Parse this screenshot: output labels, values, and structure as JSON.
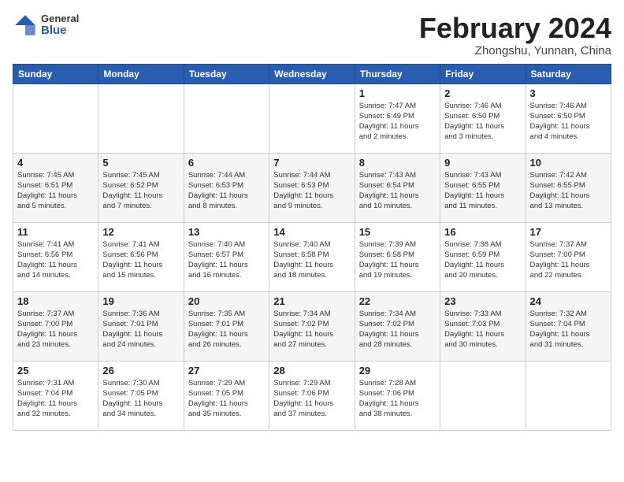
{
  "logo": {
    "general": "General",
    "blue": "Blue"
  },
  "header": {
    "month": "February 2024",
    "location": "Zhongshu, Yunnan, China"
  },
  "weekdays": [
    "Sunday",
    "Monday",
    "Tuesday",
    "Wednesday",
    "Thursday",
    "Friday",
    "Saturday"
  ],
  "weeks": [
    [
      {
        "day": "",
        "info": ""
      },
      {
        "day": "",
        "info": ""
      },
      {
        "day": "",
        "info": ""
      },
      {
        "day": "",
        "info": ""
      },
      {
        "day": "1",
        "info": "Sunrise: 7:47 AM\nSunset: 6:49 PM\nDaylight: 11 hours\nand 2 minutes."
      },
      {
        "day": "2",
        "info": "Sunrise: 7:46 AM\nSunset: 6:50 PM\nDaylight: 11 hours\nand 3 minutes."
      },
      {
        "day": "3",
        "info": "Sunrise: 7:46 AM\nSunset: 6:50 PM\nDaylight: 11 hours\nand 4 minutes."
      }
    ],
    [
      {
        "day": "4",
        "info": "Sunrise: 7:45 AM\nSunset: 6:51 PM\nDaylight: 11 hours\nand 5 minutes."
      },
      {
        "day": "5",
        "info": "Sunrise: 7:45 AM\nSunset: 6:52 PM\nDaylight: 11 hours\nand 7 minutes."
      },
      {
        "day": "6",
        "info": "Sunrise: 7:44 AM\nSunset: 6:53 PM\nDaylight: 11 hours\nand 8 minutes."
      },
      {
        "day": "7",
        "info": "Sunrise: 7:44 AM\nSunset: 6:53 PM\nDaylight: 11 hours\nand 9 minutes."
      },
      {
        "day": "8",
        "info": "Sunrise: 7:43 AM\nSunset: 6:54 PM\nDaylight: 11 hours\nand 10 minutes."
      },
      {
        "day": "9",
        "info": "Sunrise: 7:43 AM\nSunset: 6:55 PM\nDaylight: 11 hours\nand 11 minutes."
      },
      {
        "day": "10",
        "info": "Sunrise: 7:42 AM\nSunset: 6:55 PM\nDaylight: 11 hours\nand 13 minutes."
      }
    ],
    [
      {
        "day": "11",
        "info": "Sunrise: 7:41 AM\nSunset: 6:56 PM\nDaylight: 11 hours\nand 14 minutes."
      },
      {
        "day": "12",
        "info": "Sunrise: 7:41 AM\nSunset: 6:56 PM\nDaylight: 11 hours\nand 15 minutes."
      },
      {
        "day": "13",
        "info": "Sunrise: 7:40 AM\nSunset: 6:57 PM\nDaylight: 11 hours\nand 16 minutes."
      },
      {
        "day": "14",
        "info": "Sunrise: 7:40 AM\nSunset: 6:58 PM\nDaylight: 11 hours\nand 18 minutes."
      },
      {
        "day": "15",
        "info": "Sunrise: 7:39 AM\nSunset: 6:58 PM\nDaylight: 11 hours\nand 19 minutes."
      },
      {
        "day": "16",
        "info": "Sunrise: 7:38 AM\nSunset: 6:59 PM\nDaylight: 11 hours\nand 20 minutes."
      },
      {
        "day": "17",
        "info": "Sunrise: 7:37 AM\nSunset: 7:00 PM\nDaylight: 11 hours\nand 22 minutes."
      }
    ],
    [
      {
        "day": "18",
        "info": "Sunrise: 7:37 AM\nSunset: 7:00 PM\nDaylight: 11 hours\nand 23 minutes."
      },
      {
        "day": "19",
        "info": "Sunrise: 7:36 AM\nSunset: 7:01 PM\nDaylight: 11 hours\nand 24 minutes."
      },
      {
        "day": "20",
        "info": "Sunrise: 7:35 AM\nSunset: 7:01 PM\nDaylight: 11 hours\nand 26 minutes."
      },
      {
        "day": "21",
        "info": "Sunrise: 7:34 AM\nSunset: 7:02 PM\nDaylight: 11 hours\nand 27 minutes."
      },
      {
        "day": "22",
        "info": "Sunrise: 7:34 AM\nSunset: 7:02 PM\nDaylight: 11 hours\nand 28 minutes."
      },
      {
        "day": "23",
        "info": "Sunrise: 7:33 AM\nSunset: 7:03 PM\nDaylight: 11 hours\nand 30 minutes."
      },
      {
        "day": "24",
        "info": "Sunrise: 7:32 AM\nSunset: 7:04 PM\nDaylight: 11 hours\nand 31 minutes."
      }
    ],
    [
      {
        "day": "25",
        "info": "Sunrise: 7:31 AM\nSunset: 7:04 PM\nDaylight: 11 hours\nand 32 minutes."
      },
      {
        "day": "26",
        "info": "Sunrise: 7:30 AM\nSunset: 7:05 PM\nDaylight: 11 hours\nand 34 minutes."
      },
      {
        "day": "27",
        "info": "Sunrise: 7:29 AM\nSunset: 7:05 PM\nDaylight: 11 hours\nand 35 minutes."
      },
      {
        "day": "28",
        "info": "Sunrise: 7:29 AM\nSunset: 7:06 PM\nDaylight: 11 hours\nand 37 minutes."
      },
      {
        "day": "29",
        "info": "Sunrise: 7:28 AM\nSunset: 7:06 PM\nDaylight: 11 hours\nand 38 minutes."
      },
      {
        "day": "",
        "info": ""
      },
      {
        "day": "",
        "info": ""
      }
    ]
  ]
}
